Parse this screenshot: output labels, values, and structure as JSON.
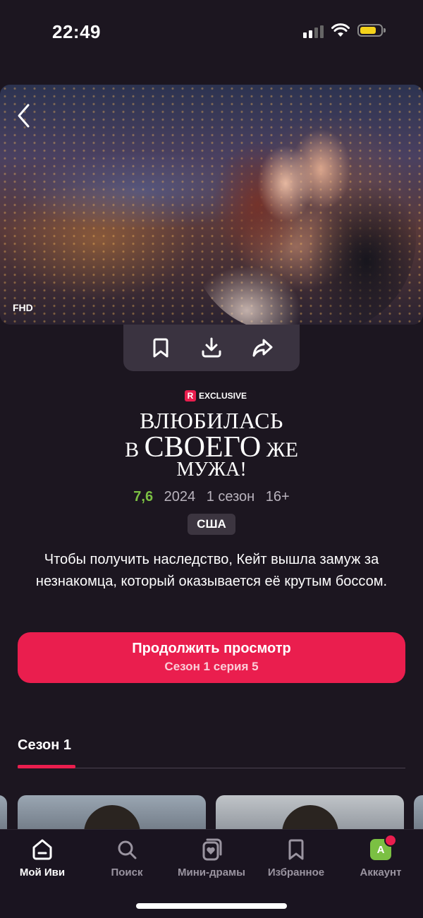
{
  "status_bar": {
    "time": "22:49",
    "signal_icon": "cellular-signal-icon",
    "wifi_icon": "wifi-icon",
    "battery_icon": "battery-icon",
    "battery_color": "#f4d21a"
  },
  "hero": {
    "quality_badge": "FHD",
    "back_icon": "chevron-left-icon"
  },
  "actions": {
    "bookmark_icon": "bookmark-icon",
    "download_icon": "download-icon",
    "share_icon": "share-icon"
  },
  "show": {
    "badge": "EXCLUSIVE",
    "badge_logo": "R",
    "title_line1": "ВЛЮБИЛАСЬ",
    "title_line2_a": "В",
    "title_line2_b": "СВОЕГО",
    "title_line2_c": "ЖЕ",
    "title_line3": "МУЖА!",
    "rating": "7,6",
    "year": "2024",
    "seasons": "1 сезон",
    "age": "16+",
    "country": "США",
    "description": "Чтобы получить наследство, Кейт вышла замуж за незнакомца, который оказывается её крутым боссом."
  },
  "cta": {
    "title": "Продолжить просмотр",
    "subtitle": "Сезон 1 серия 5"
  },
  "season_tabs": {
    "active": "Сезон 1"
  },
  "colors": {
    "accent": "#ea1e4e",
    "rating": "#7bc043",
    "background": "#1c1620"
  },
  "tabbar": {
    "items": [
      {
        "label": "Мой Иви",
        "icon": "home-icon"
      },
      {
        "label": "Поиск",
        "icon": "search-icon"
      },
      {
        "label": "Мини-драмы",
        "icon": "mini-drama-icon"
      },
      {
        "label": "Избранное",
        "icon": "bookmark-icon"
      },
      {
        "label": "Аккаунт",
        "icon": "avatar-icon",
        "avatar_letter": "A"
      }
    ]
  }
}
